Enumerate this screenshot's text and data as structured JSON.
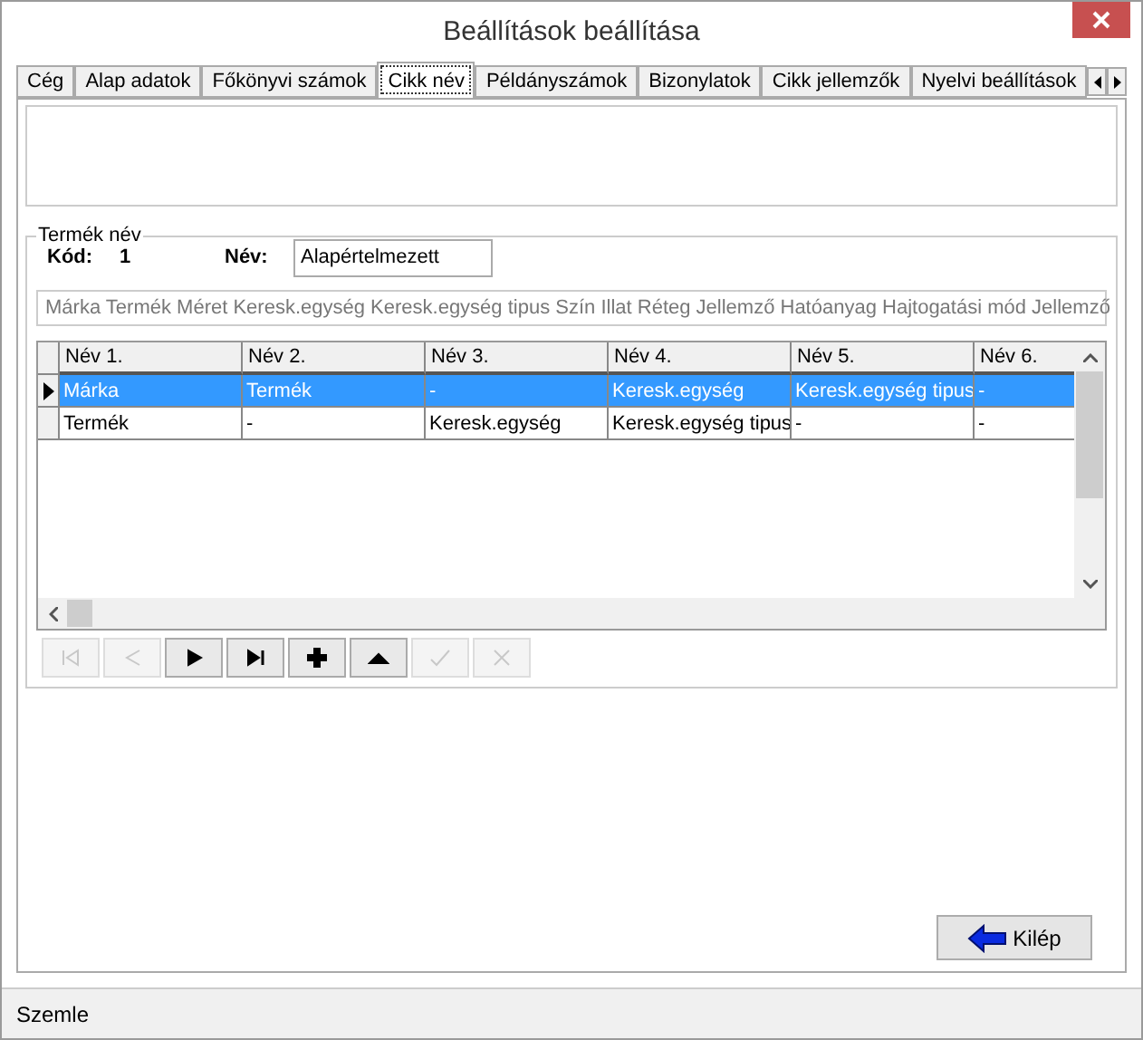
{
  "window": {
    "title": "Beállítások beállítása"
  },
  "tabs": [
    {
      "label": "Cég",
      "selected": false
    },
    {
      "label": "Alap adatok",
      "selected": false
    },
    {
      "label": "Főkönyvi számok",
      "selected": false
    },
    {
      "label": "Cikk név",
      "selected": true
    },
    {
      "label": "Példányszámok",
      "selected": false
    },
    {
      "label": "Bizonylatok",
      "selected": false
    },
    {
      "label": "Cikk jellemzők",
      "selected": false
    },
    {
      "label": "Nyelvi beállítások",
      "selected": false
    }
  ],
  "group": {
    "title": "Termék név",
    "code_label": "Kód:",
    "code_value": "1",
    "name_label": "Név:",
    "name_value": "Alapértelmezett"
  },
  "summary": "Márka Termék Méret Keresk.egység Keresk.egység tipus Szín Illat Réteg Jellemző Hatóanyag Hajtogatási mód Jellemző",
  "table": {
    "columns": [
      "Név 1.",
      "Név 2.",
      "Név 3.",
      "Név 4.",
      "Név 5.",
      "Név 6."
    ],
    "rows": [
      {
        "selected": true,
        "cells": [
          "Márka",
          "Termék",
          "-",
          "Keresk.egység",
          "Keresk.egység tipus",
          "-"
        ]
      },
      {
        "selected": false,
        "cells": [
          "Termék",
          "-",
          "Keresk.egység",
          "Keresk.egység tipus",
          "-",
          "-"
        ]
      }
    ]
  },
  "navigator": [
    {
      "kind": "first",
      "disabled": true
    },
    {
      "kind": "prior",
      "disabled": true
    },
    {
      "kind": "next",
      "disabled": false
    },
    {
      "kind": "last",
      "disabled": false
    },
    {
      "kind": "insert",
      "disabled": false
    },
    {
      "kind": "delete",
      "disabled": false
    },
    {
      "kind": "post",
      "disabled": true
    },
    {
      "kind": "cancel",
      "disabled": true
    }
  ],
  "exit_button": {
    "label": "Kilép"
  },
  "status_bar": "Szemle"
}
